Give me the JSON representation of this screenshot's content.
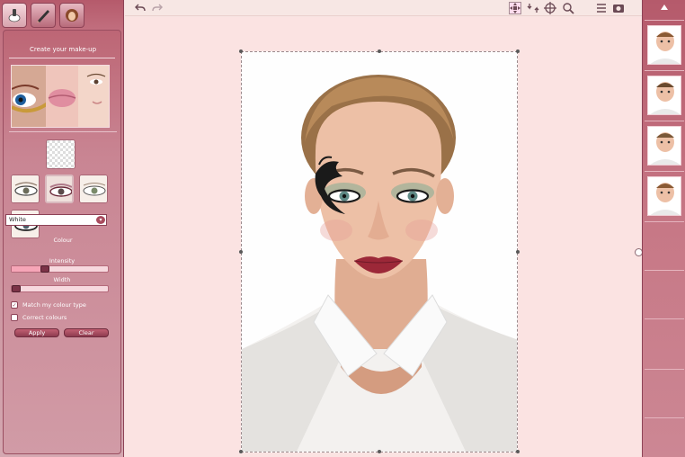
{
  "left_panel": {
    "tabs": [
      {
        "icon": "makeup-brush-icon",
        "active": true
      },
      {
        "icon": "makeup-pencil-icon",
        "active": false
      },
      {
        "icon": "hairstyle-face-icon",
        "active": false
      }
    ],
    "title": "Create your make-up",
    "colour_label": "Colour",
    "colour_value": "White",
    "intensity_label": "Intensity",
    "intensity_level": 0.35,
    "width_label": "Width",
    "width_level": 0.04,
    "match_colour_type": {
      "label": "Match my colour type",
      "checked": true
    },
    "correct_colours": {
      "label": "Correct colours",
      "checked": false
    },
    "apply_label": "Apply",
    "clear_label": "Clear"
  },
  "toolbar": {
    "undo_icon": "undo-icon",
    "redo_icon": "redo-icon",
    "move_icon": "move-icon",
    "rotate_icon": "rotate-icon",
    "pan_icon": "pan-icon",
    "zoom_icon": "zoom-icon",
    "menu_icon": "menu-icon",
    "camera_icon": "camera-icon"
  },
  "right_panel": {
    "scroll_up_icon": "scroll-up-icon",
    "thumbnail_count": 4
  },
  "colors": {
    "accent": "#b55a6b",
    "canvas_bg": "#fbe3e2",
    "button": "#8d3c50"
  }
}
